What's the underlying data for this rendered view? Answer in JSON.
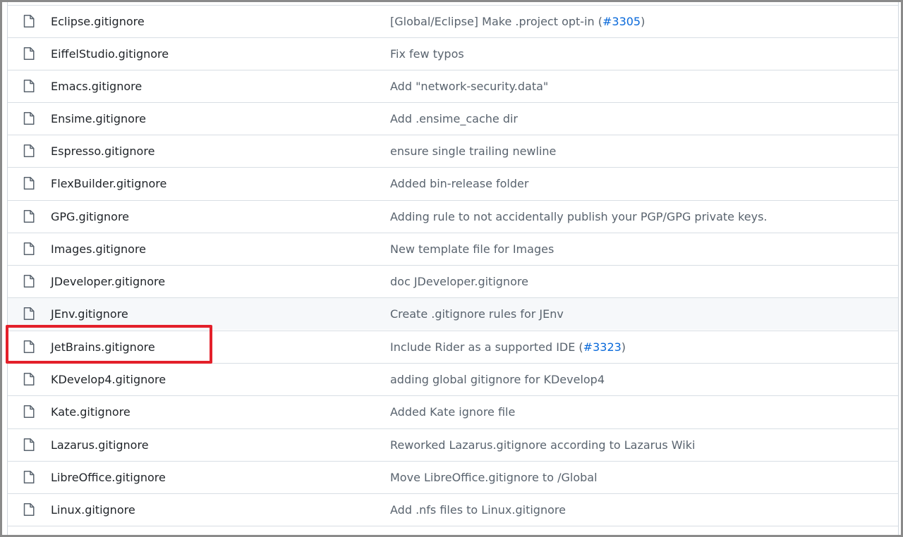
{
  "files": [
    {
      "name": "Eclipse.gitignore",
      "commit_before": "[Global/Eclipse] Make .project opt-in (",
      "link": "#3305",
      "commit_after": ")"
    },
    {
      "name": "EiffelStudio.gitignore",
      "commit_before": "Fix few typos",
      "link": "",
      "commit_after": ""
    },
    {
      "name": "Emacs.gitignore",
      "commit_before": "Add \"network-security.data\"",
      "link": "",
      "commit_after": ""
    },
    {
      "name": "Ensime.gitignore",
      "commit_before": "Add .ensime_cache dir",
      "link": "",
      "commit_after": ""
    },
    {
      "name": "Espresso.gitignore",
      "commit_before": "ensure single trailing newline",
      "link": "",
      "commit_after": ""
    },
    {
      "name": "FlexBuilder.gitignore",
      "commit_before": "Added bin-release folder",
      "link": "",
      "commit_after": ""
    },
    {
      "name": "GPG.gitignore",
      "commit_before": "Adding rule to not accidentally publish your PGP/GPG private keys.",
      "link": "",
      "commit_after": ""
    },
    {
      "name": "Images.gitignore",
      "commit_before": "New template file for Images",
      "link": "",
      "commit_after": ""
    },
    {
      "name": "JDeveloper.gitignore",
      "commit_before": "doc JDeveloper.gitignore",
      "link": "",
      "commit_after": ""
    },
    {
      "name": "JEnv.gitignore",
      "commit_before": "Create .gitignore rules for JEnv",
      "link": "",
      "commit_after": ""
    },
    {
      "name": "JetBrains.gitignore",
      "commit_before": "Include Rider as a supported IDE (",
      "link": "#3323",
      "commit_after": ")"
    },
    {
      "name": "KDevelop4.gitignore",
      "commit_before": "adding global gitignore for KDevelop4",
      "link": "",
      "commit_after": ""
    },
    {
      "name": "Kate.gitignore",
      "commit_before": "Added Kate ignore file",
      "link": "",
      "commit_after": ""
    },
    {
      "name": "Lazarus.gitignore",
      "commit_before": "Reworked Lazarus.gitignore according to Lazarus Wiki",
      "link": "",
      "commit_after": ""
    },
    {
      "name": "LibreOffice.gitignore",
      "commit_before": "Move LibreOffice.gitignore to /Global",
      "link": "",
      "commit_after": ""
    },
    {
      "name": "Linux.gitignore",
      "commit_before": "Add .nfs files to Linux.gitignore",
      "link": "",
      "commit_after": ""
    }
  ],
  "icons": {
    "file": "file-icon"
  },
  "colors": {
    "link": "#0969da",
    "highlight": "#e3202a",
    "hover_row": "#f6f8fa"
  }
}
